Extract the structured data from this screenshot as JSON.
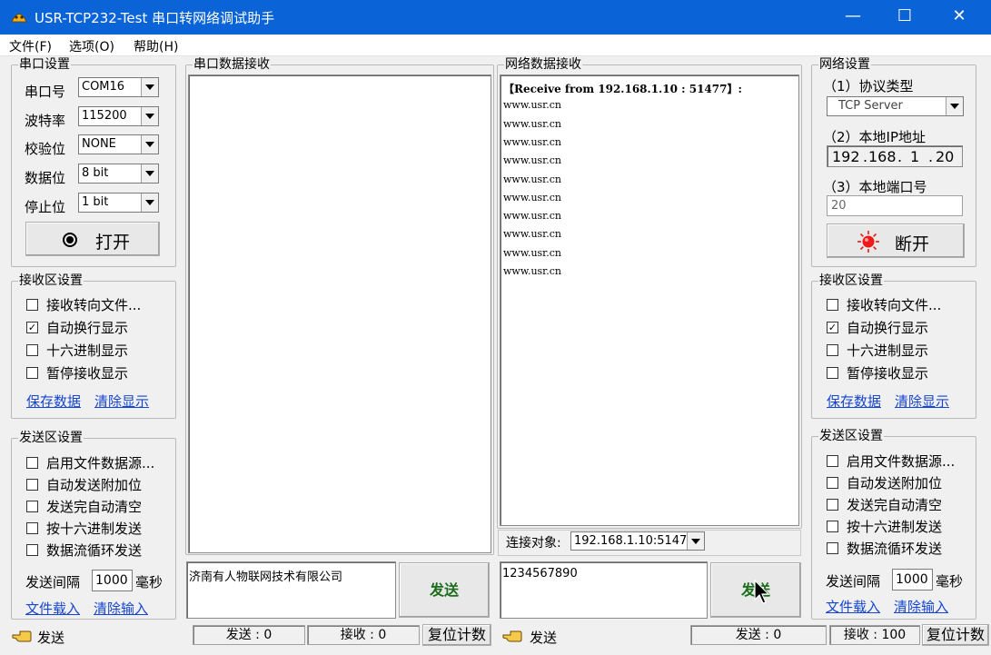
{
  "window": {
    "title": "USR-TCP232-Test 串口转网络调试助手",
    "minimize_glyph": "—",
    "maximize_glyph": "☐",
    "close_glyph": "✕",
    "title_bg": "#0a64d8"
  },
  "menu": {
    "items": [
      "文件(F)",
      "选项(O)",
      "帮助(H)"
    ]
  },
  "serial_settings": {
    "title": "串口设置",
    "port_label": "串口号",
    "port_value": "COM16",
    "baud_label": "波特率",
    "baud_value": "115200",
    "parity_label": "校验位",
    "parity_value": "NONE",
    "databits_label": "数据位",
    "databits_value": "8 bit",
    "stopbits_label": "停止位",
    "stopbits_value": "1 bit",
    "open_button": "打开",
    "open_icon": "radio-dot-icon"
  },
  "left_receive_settings": {
    "title": "接收区设置",
    "options": [
      {
        "label": "接收转向文件...",
        "checked": false
      },
      {
        "label": "自动换行显示",
        "checked": true
      },
      {
        "label": "十六进制显示",
        "checked": false
      },
      {
        "label": "暂停接收显示",
        "checked": false
      }
    ],
    "save_link": "保存数据",
    "clear_link": "清除显示"
  },
  "left_send_settings": {
    "title": "发送区设置",
    "options": [
      {
        "label": "启用文件数据源...",
        "checked": false
      },
      {
        "label": "自动发送附加位",
        "checked": false
      },
      {
        "label": "发送完自动清空",
        "checked": false
      },
      {
        "label": "按十六进制发送",
        "checked": false
      },
      {
        "label": "数据流循环发送",
        "checked": false
      }
    ],
    "interval_label": "发送间隔",
    "interval_value": "1000",
    "interval_unit": "毫秒",
    "load_link": "文件载入",
    "clear_link": "清除输入"
  },
  "serial_receive": {
    "title": "串口数据接收"
  },
  "serial_send": {
    "input_value": "济南有人物联网技术有限公司",
    "send_button": "发送"
  },
  "network_receive": {
    "title": "网络数据接收",
    "lines": [
      "【Receive from 192.168.1.10 : 51477】:",
      "www.usr.cn",
      "www.usr.cn",
      "www.usr.cn",
      "www.usr.cn",
      "www.usr.cn",
      "www.usr.cn",
      "www.usr.cn",
      "www.usr.cn",
      "www.usr.cn",
      "www.usr.cn"
    ]
  },
  "connection": {
    "label": "连接对象:",
    "value": "192.168.1.10:51477"
  },
  "network_send": {
    "input_value": "1234567890",
    "send_button": "发送"
  },
  "network_settings": {
    "title": "网络设置",
    "protocol_label": "（1）协议类型",
    "protocol_value": "TCP Server",
    "ip_label": "（2）本地IP地址",
    "ip_octets": [
      "192",
      "168",
      "1",
      "20"
    ],
    "ip_dot": ".",
    "port_label": "（3）本地端口号",
    "port_value": "20",
    "disconnect_button": "断开",
    "disconnect_icon": "red-led-icon"
  },
  "right_receive_settings": {
    "title": "接收区设置",
    "options": [
      {
        "label": "接收转向文件...",
        "checked": false
      },
      {
        "label": "自动换行显示",
        "checked": true
      },
      {
        "label": "十六进制显示",
        "checked": false
      },
      {
        "label": "暂停接收显示",
        "checked": false
      }
    ],
    "save_link": "保存数据",
    "clear_link": "清除显示"
  },
  "right_send_settings": {
    "title": "发送区设置",
    "options": [
      {
        "label": "启用文件数据源...",
        "checked": false
      },
      {
        "label": "自动发送附加位",
        "checked": false
      },
      {
        "label": "发送完自动清空",
        "checked": false
      },
      {
        "label": "按十六进制发送",
        "checked": false
      },
      {
        "label": "数据流循环发送",
        "checked": false
      }
    ],
    "interval_label": "发送间隔",
    "interval_value": "1000",
    "interval_unit": "毫秒",
    "load_link": "文件载入",
    "clear_link": "清除输入"
  },
  "status": {
    "left_icon": "hand-pointer-icon",
    "left_text": "发送",
    "serial_sent": "发送 : 0",
    "serial_received": "接收 : 0",
    "serial_reset": "复位计数",
    "right_text": "发送",
    "net_sent": "发送 : 0",
    "net_received": "接收 : 100",
    "net_reset": "复位计数"
  },
  "check_glyph": "✓"
}
